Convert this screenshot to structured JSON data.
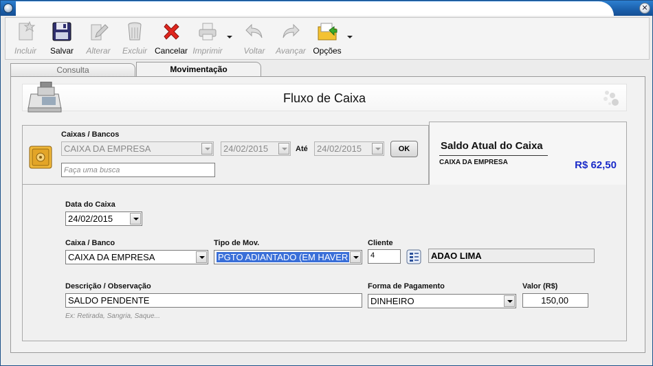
{
  "toolbar": {
    "buttons": [
      {
        "label": "Incluir",
        "enabled": false,
        "icon": "new-document-icon"
      },
      {
        "label": "Salvar",
        "enabled": true,
        "icon": "floppy-disk-icon"
      },
      {
        "label": "Alterar",
        "enabled": false,
        "icon": "edit-pencil-icon"
      },
      {
        "label": "Excluir",
        "enabled": false,
        "icon": "trash-can-icon"
      },
      {
        "label": "Cancelar",
        "enabled": true,
        "icon": "red-x-icon"
      },
      {
        "label": "Imprimir",
        "enabled": false,
        "icon": "printer-icon"
      },
      {
        "label": "Voltar",
        "enabled": false,
        "icon": "back-arrow-icon"
      },
      {
        "label": "Avançar",
        "enabled": false,
        "icon": "forward-arrow-icon"
      },
      {
        "label": "Opções",
        "enabled": true,
        "icon": "options-folder-icon"
      }
    ]
  },
  "tabs": {
    "consulta": "Consulta",
    "movimentacao": "Movimentação"
  },
  "header": {
    "title": "Fluxo de Caixa"
  },
  "filter": {
    "caixas_label": "Caixas / Bancos",
    "caixa_value": "CAIXA DA EMPRESA",
    "date_from": "24/02/2015",
    "ate_label": "Até",
    "date_to": "24/02/2015",
    "ok_label": "OK",
    "search_placeholder": "Faça uma busca"
  },
  "saldo": {
    "title": "Saldo Atual do Caixa",
    "caixa": "CAIXA DA EMPRESA",
    "valor": "R$ 62,50"
  },
  "form": {
    "data_label": "Data do Caixa",
    "data_value": "24/02/2015",
    "caixa_label": "Caixa / Banco",
    "caixa_value": "CAIXA DA EMPRESA",
    "tipo_label": "Tipo de Mov.",
    "tipo_value": "PGTO ADIANTADO (EM HAVER",
    "cliente_label": "Cliente",
    "cliente_code": "4",
    "cliente_name": "ADAO LIMA",
    "descricao_label": "Descrição / Observação",
    "descricao_value": "SALDO PENDENTE",
    "descricao_hint": "Ex: Retirada, Sangria, Saque...",
    "forma_label": "Forma de Pagamento",
    "forma_value": "DINHEIRO",
    "valor_label": "Valor (R$)",
    "valor_value": "150,00"
  },
  "colors": {
    "saldo_value": "#1a2bc8",
    "titlebar": "#1a5fab",
    "selection": "#3a6fd8"
  }
}
